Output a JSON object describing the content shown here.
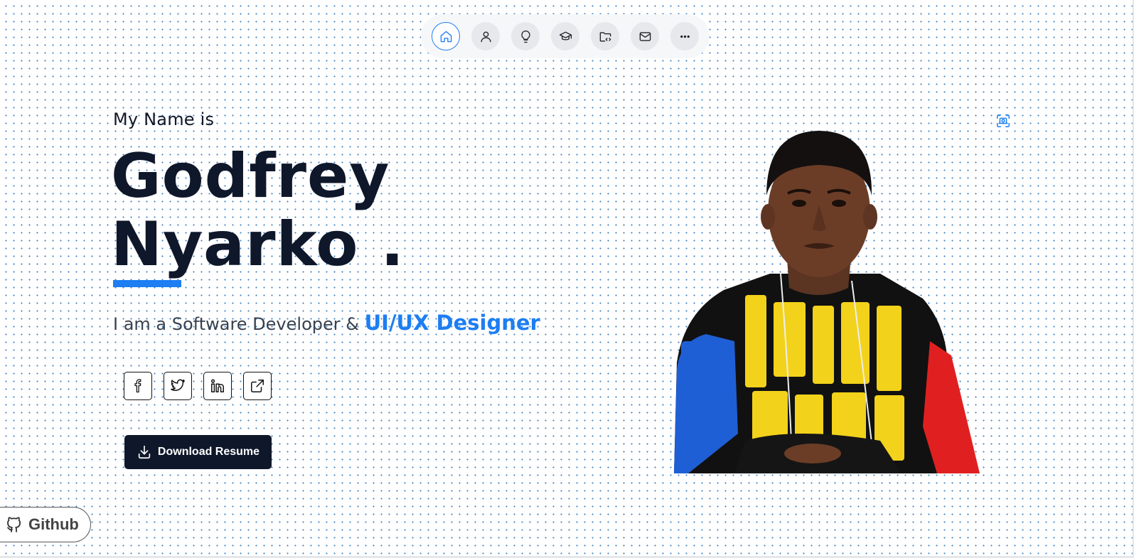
{
  "nav": {
    "items": [
      {
        "name": "home",
        "icon": "home-icon",
        "active": true
      },
      {
        "name": "about",
        "icon": "user-icon",
        "active": false
      },
      {
        "name": "skills",
        "icon": "lightbulb-icon",
        "active": false
      },
      {
        "name": "education",
        "icon": "graduation-cap-icon",
        "active": false
      },
      {
        "name": "projects",
        "icon": "folder-code-icon",
        "active": false
      },
      {
        "name": "contact",
        "icon": "mail-icon",
        "active": false
      },
      {
        "name": "more",
        "icon": "more-horizontal-icon",
        "active": false
      }
    ]
  },
  "hero": {
    "greeting": "My Name is",
    "first_name": "Godfrey",
    "last_name": "Nyarko .",
    "tagline_prefix": "I am a Software Developer &",
    "tagline_highlight": "UI/UX Designer"
  },
  "socials": [
    {
      "name": "facebook",
      "icon": "facebook-icon"
    },
    {
      "name": "twitter",
      "icon": "twitter-icon"
    },
    {
      "name": "linkedin",
      "icon": "linkedin-icon"
    },
    {
      "name": "external",
      "icon": "external-link-icon"
    }
  ],
  "download": {
    "label": "Download Resume",
    "icon": "download-icon"
  },
  "github": {
    "label": "Github",
    "icon": "github-icon"
  },
  "capture": {
    "icon": "screenshot-capture-icon"
  },
  "colors": {
    "accent": "#1d7ef2",
    "dark": "#0f172a",
    "dots": "#3b82c4"
  }
}
